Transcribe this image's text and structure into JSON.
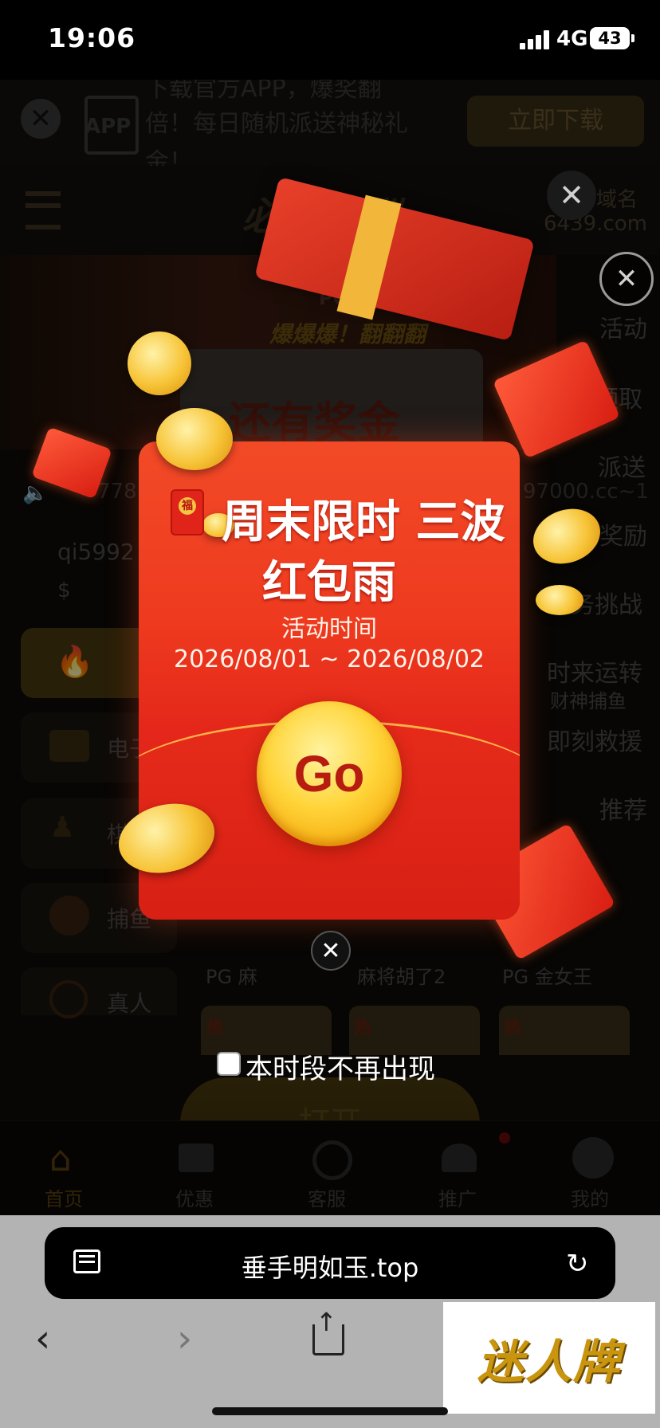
{
  "status_bar": {
    "time": "19:06",
    "network": "4G",
    "battery": "43"
  },
  "app_banner": {
    "line1": "下载官方APP，爆奖翻",
    "line2": "倍！每日随机派送神秘礼",
    "line3": "金！",
    "app_icon_label": "APP",
    "download_button": "立即下载"
  },
  "site_header": {
    "logo": "必赢亚洲",
    "domain_label": "域名",
    "domain": "6439.com"
  },
  "hero_banner": {
    "provider": "PG",
    "slogan": "爆爆爆！翻翻翻",
    "bonus_text": "还有奖金"
  },
  "marquee": {
    "left_text": "778",
    "right_text": "97000.cc~1"
  },
  "user": {
    "name": "qi5992",
    "balance": "$"
  },
  "categories": [
    {
      "label": "",
      "icon": "flame-icon"
    },
    {
      "label": "电子",
      "icon": "slot-machine-icon"
    },
    {
      "label": "棋牌",
      "icon": "chess-icon"
    },
    {
      "label": "捕鱼",
      "icon": "fish-icon"
    },
    {
      "label": "真人",
      "icon": "chip-icon"
    }
  ],
  "side_menu": [
    "活动",
    "一键领取",
    "派送",
    "到奖励",
    "任务挑战",
    "时来运转",
    "即刻救援",
    "推荐"
  ],
  "side_sub": {
    "fish_game": "财神捕鱼"
  },
  "games": {
    "labels": [
      "PG 麻",
      "麻将胡了2",
      "PG 金女王"
    ],
    "hot_badge": "热"
  },
  "open_button": "打开",
  "bottom_nav": [
    {
      "label": "首页",
      "icon": "home-icon"
    },
    {
      "label": "优惠",
      "icon": "gift-icon"
    },
    {
      "label": "客服",
      "icon": "headset-icon"
    },
    {
      "label": "推广",
      "icon": "share-icon"
    },
    {
      "label": "我的",
      "icon": "user-icon"
    }
  ],
  "popup": {
    "title_line1": "周末限时 三波",
    "title_line2": "红包雨",
    "subtitle": "活动时间",
    "date_range": "2026/08/01 ~ 2026/08/02",
    "go_button": "Go",
    "envelope_char": "福",
    "dont_show_again": "本时段不再出现"
  },
  "browser": {
    "url": "垂手明如玉.top"
  },
  "watermark": "迷人牌",
  "colors": {
    "accent_gold": "#f5b92e",
    "packet_red": "#ee3a1f",
    "go_text": "#b71c10"
  }
}
